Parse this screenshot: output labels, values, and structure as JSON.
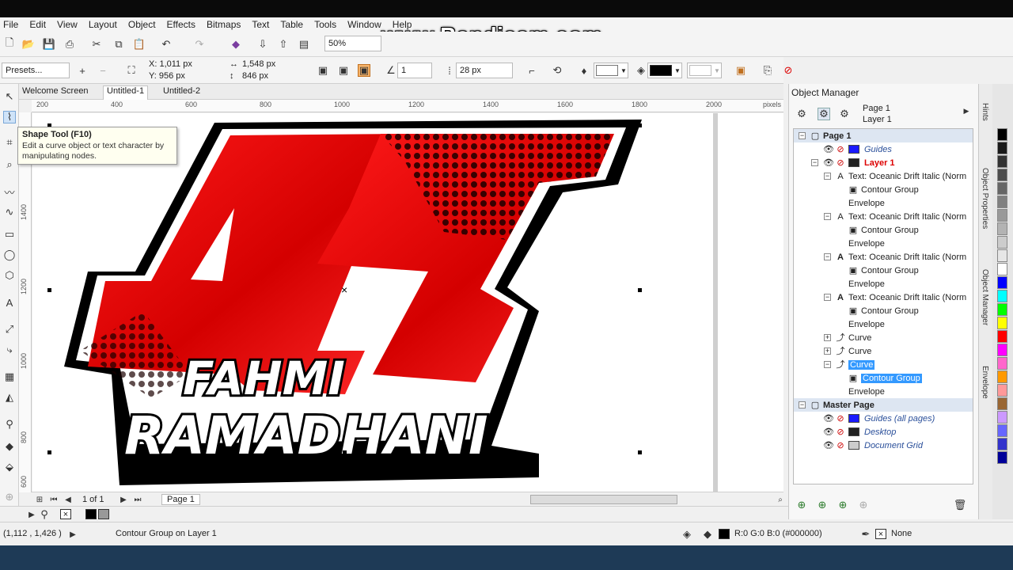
{
  "menu": [
    "File",
    "Edit",
    "View",
    "Layout",
    "Object",
    "Effects",
    "Bitmaps",
    "Text",
    "Table",
    "Tools",
    "Window",
    "Help"
  ],
  "watermark": "www.Bandicam.com",
  "toolbar": {
    "zoom": "50%"
  },
  "propbar": {
    "presets": "Presets...",
    "x": "X: 1,011 px",
    "y": "Y: 956 px",
    "w": "1,548 px",
    "h": "846 px",
    "steps": "1",
    "offset": "28 px"
  },
  "doc_tabs": [
    "Welcome Screen",
    "Untitled-1",
    "Untitled-2"
  ],
  "ruler_h": [
    "200",
    "400",
    "600",
    "800",
    "1000",
    "1200",
    "1400",
    "1600",
    "1800",
    "2000",
    "pixels"
  ],
  "ruler_v": [
    "1400",
    "1200",
    "1000",
    "800",
    "600"
  ],
  "tooltip": {
    "title": "Shape Tool (F10)",
    "body": "Edit a curve object or text character by manipulating nodes."
  },
  "artwork": {
    "number": "41",
    "line1": "FAHMI",
    "line2": "RAMADHANI"
  },
  "nav": {
    "page_count": "1 of 1",
    "page_tab": "Page 1"
  },
  "status": {
    "coords": "(1,112 , 1,426 )",
    "selection": "Contour Group on Layer 1",
    "fill": "R:0 G:0 B:0 (#000000)",
    "outline": "None"
  },
  "object_manager": {
    "title": "Object Manager",
    "page": "Page 1",
    "layer": "Layer 1",
    "tree": [
      {
        "label": "Page 1",
        "indent": 0,
        "toggle": "−",
        "type": "page"
      },
      {
        "label": "Guides",
        "indent": 1,
        "swatch": "#1a1aff",
        "type": "layer-italic"
      },
      {
        "label": "Layer 1",
        "indent": 1,
        "toggle": "−",
        "swatch": "#222222",
        "type": "layer-active"
      },
      {
        "label": "Text: Oceanic Drift Italic (Norm",
        "indent": 2,
        "toggle": "−",
        "type": "text-outline"
      },
      {
        "label": "Contour Group",
        "indent": 3,
        "type": "group"
      },
      {
        "label": "Envelope",
        "indent": 3,
        "type": "plain"
      },
      {
        "label": "Text: Oceanic Drift Italic (Norm",
        "indent": 2,
        "toggle": "−",
        "type": "text-outline"
      },
      {
        "label": "Contour Group",
        "indent": 3,
        "type": "group"
      },
      {
        "label": "Envelope",
        "indent": 3,
        "type": "plain"
      },
      {
        "label": "Text: Oceanic Drift Italic (Norm",
        "indent": 2,
        "toggle": "−",
        "type": "text"
      },
      {
        "label": "Contour Group",
        "indent": 3,
        "type": "group"
      },
      {
        "label": "Envelope",
        "indent": 3,
        "type": "plain"
      },
      {
        "label": "Text: Oceanic Drift Italic (Norm",
        "indent": 2,
        "toggle": "−",
        "type": "text"
      },
      {
        "label": "Contour Group",
        "indent": 3,
        "type": "group"
      },
      {
        "label": "Envelope",
        "indent": 3,
        "type": "plain"
      },
      {
        "label": "Curve",
        "indent": 2,
        "toggle": "+",
        "type": "curve"
      },
      {
        "label": "Curve",
        "indent": 2,
        "toggle": "+",
        "type": "curve"
      },
      {
        "label": "Curve",
        "indent": 2,
        "toggle": "−",
        "type": "curve-selected"
      },
      {
        "label": "Contour Group",
        "indent": 3,
        "type": "group-selected"
      },
      {
        "label": "Envelope",
        "indent": 3,
        "type": "plain"
      },
      {
        "label": "Master Page",
        "indent": 0,
        "toggle": "−",
        "type": "page"
      },
      {
        "label": "Guides (all pages)",
        "indent": 1,
        "swatch": "#1a1aff",
        "type": "layer-italic"
      },
      {
        "label": "Desktop",
        "indent": 1,
        "swatch": "#222222",
        "type": "layer-italic"
      },
      {
        "label": "Document Grid",
        "indent": 1,
        "swatch": "#cccccc",
        "type": "layer-italic"
      }
    ]
  },
  "dock_tabs": [
    "Hints",
    "Object Properties",
    "Object Manager",
    "Envelope"
  ],
  "palette": [
    "#000000",
    "#1a1a1a",
    "#333333",
    "#4d4d4d",
    "#666666",
    "#808080",
    "#999999",
    "#b3b3b3",
    "#cccccc",
    "#e6e6e6",
    "#ffffff",
    "#0000ff",
    "#00ffff",
    "#00ff00",
    "#ffff00",
    "#ff0000",
    "#ff00ff",
    "#ff66cc",
    "#ff9900",
    "#ff9999",
    "#996633",
    "#cc99ff",
    "#6666ff",
    "#3333cc",
    "#000099"
  ]
}
